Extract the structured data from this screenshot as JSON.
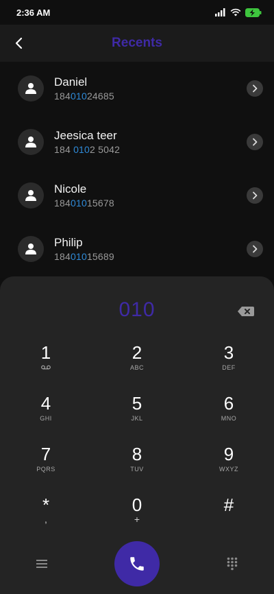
{
  "status_bar": {
    "time": "2:36 AM",
    "icons": [
      "signal-icon",
      "wifi-icon",
      "battery-charging-icon"
    ]
  },
  "header": {
    "title": "Recents",
    "back_icon": "chevron-left-icon"
  },
  "recents": [
    {
      "name": "Daniel",
      "number_prefix": "184",
      "number_match": "010",
      "number_suffix": "24685"
    },
    {
      "name": "Jeesica teer",
      "number_prefix": "184 ",
      "number_match": "010",
      "number_suffix": "2 5042"
    },
    {
      "name": "Nicole",
      "number_prefix": "184",
      "number_match": "010",
      "number_suffix": "15678"
    },
    {
      "name": "Philip",
      "number_prefix": "184",
      "number_match": "010",
      "number_suffix": "15689"
    }
  ],
  "dialer": {
    "input": "010",
    "keys": [
      {
        "digit": "1",
        "letters": ""
      },
      {
        "digit": "2",
        "letters": "ABC"
      },
      {
        "digit": "3",
        "letters": "DEF"
      },
      {
        "digit": "4",
        "letters": "GHI"
      },
      {
        "digit": "5",
        "letters": "JKL"
      },
      {
        "digit": "6",
        "letters": "MNO"
      },
      {
        "digit": "7",
        "letters": "PQRS"
      },
      {
        "digit": "8",
        "letters": "TUV"
      },
      {
        "digit": "9",
        "letters": "WXYZ"
      },
      {
        "digit": "*",
        "letters": ","
      },
      {
        "digit": "0",
        "letters": "+"
      },
      {
        "digit": "#",
        "letters": ""
      }
    ]
  },
  "colors": {
    "accent": "#3f2aa6",
    "match_highlight": "#2f8bd9",
    "panel": "#242424",
    "background": "#0f0f0f"
  }
}
